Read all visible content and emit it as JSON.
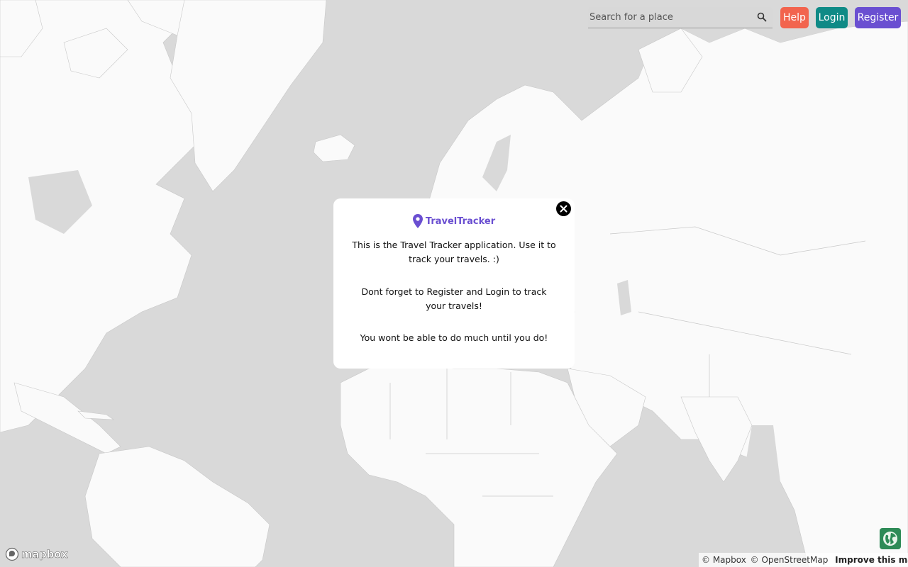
{
  "header": {
    "search_placeholder": "Search for a place",
    "help_label": "Help",
    "login_label": "Login",
    "register_label": "Register"
  },
  "modal": {
    "brand_name": "TravelTracker",
    "paragraph_1": "This is the Travel Tracker application. Use it to track your travels. :)",
    "paragraph_2": "Dont forget to Register and Login to track your travels!",
    "paragraph_3": "You wont be able to do much until you do!"
  },
  "footer": {
    "logo_text": "mapbox",
    "attribution_mapbox": "© Mapbox",
    "attribution_osm": "© OpenStreetMap",
    "improve_link": "Improve this map"
  },
  "icons": {
    "search": "search-icon",
    "close": "close-icon",
    "brand": "map-pin-icon",
    "globe": "globe-icon"
  },
  "colors": {
    "help": "#f2644e",
    "login": "#0f8a86",
    "register": "#6a4fd1",
    "brand": "#6a4fd1",
    "water": "#d9d9d9",
    "land": "#fafafa"
  }
}
